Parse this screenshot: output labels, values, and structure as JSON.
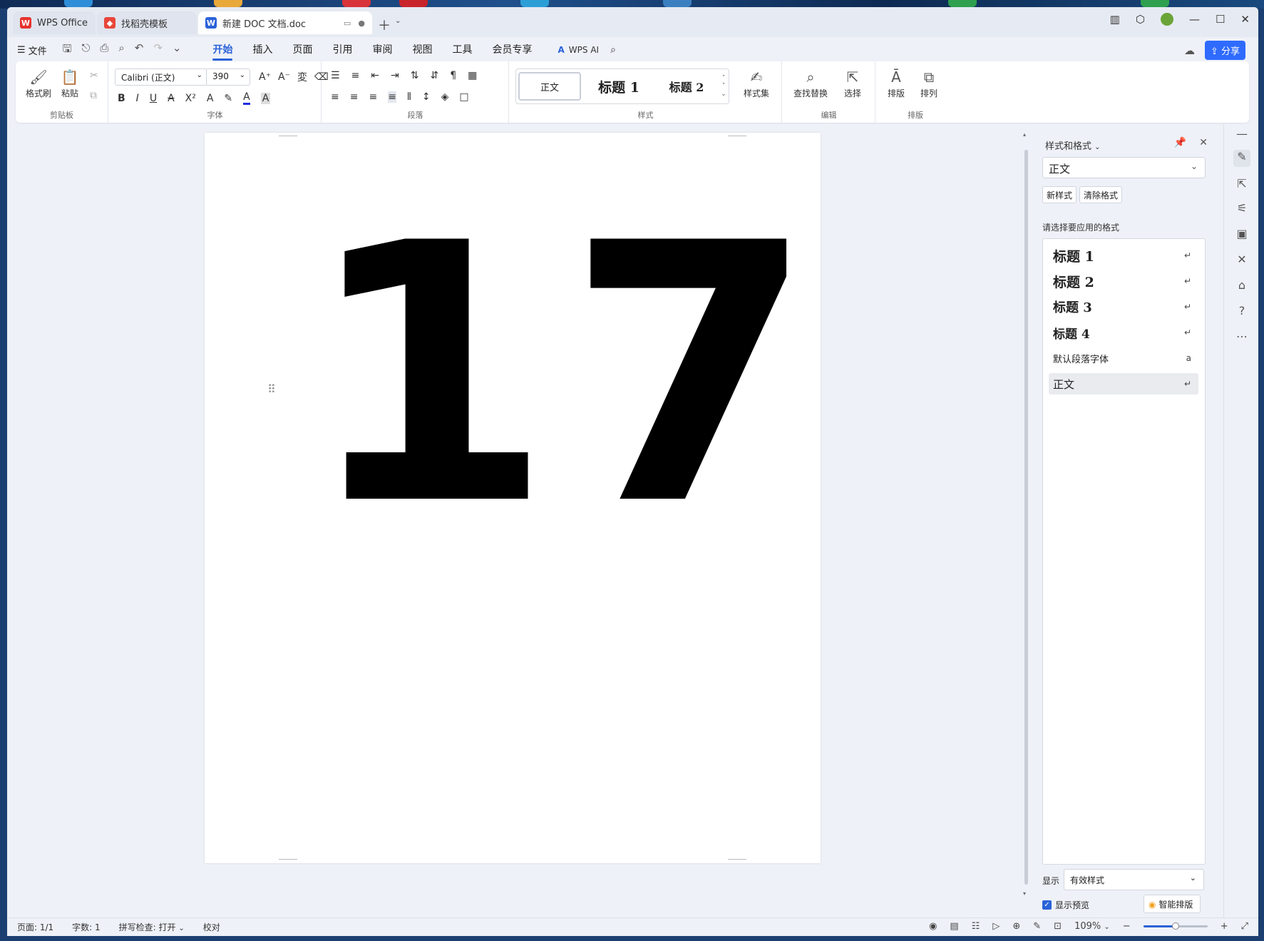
{
  "tabs": [
    {
      "label": "WPS Office",
      "icon": "wps-logo-icon"
    },
    {
      "label": "找稻壳模板",
      "icon": "docer-icon"
    },
    {
      "label": "新建 DOC 文档.doc",
      "icon": "word-doc-icon"
    }
  ],
  "menu": {
    "file": "文件",
    "tabs": [
      "开始",
      "插入",
      "页面",
      "引用",
      "审阅",
      "视图",
      "工具",
      "会员专享"
    ],
    "active_tab": "开始",
    "wps_ai": "WPS AI",
    "share": "分享"
  },
  "ribbon": {
    "clipboard": {
      "format_painter": "格式刷",
      "paste": "粘贴",
      "label": "剪贴板"
    },
    "font": {
      "family": "Calibri (正文)",
      "size": "390",
      "label": "字体"
    },
    "paragraph": {
      "label": "段落"
    },
    "styles": {
      "gallery": [
        "正文",
        "标题 1",
        "标题 2"
      ],
      "style_set": "样式集",
      "label": "样式"
    },
    "edit": {
      "find_replace": "查找替换",
      "select": "选择",
      "label": "编辑"
    },
    "layout": {
      "typeset": "排版",
      "arrange": "排列",
      "label": "排版"
    }
  },
  "document": {
    "content": "17"
  },
  "panel": {
    "title": "样式和格式",
    "current_style": "正文",
    "new_style": "新样式",
    "clear_format": "清除格式",
    "hint": "请选择要应用的格式",
    "styles": [
      "标题 1",
      "标题 2",
      "标题 3",
      "标题 4",
      "默认段落字体",
      "正文"
    ],
    "selected_style": "正文",
    "show_label": "显示",
    "show_value": "有效样式",
    "preview_label": "显示预览",
    "preview_checked": true,
    "smart_layout": "智能排版"
  },
  "status": {
    "page": "页面: 1/1",
    "words": "字数: 1",
    "spell": "拼写检查: 打开",
    "proof": "校对",
    "zoom": "109%",
    "zoom_slider_fraction": 0.5
  },
  "colors": {
    "accent": "#2b62d9",
    "share_bg": "#2f6bff"
  }
}
